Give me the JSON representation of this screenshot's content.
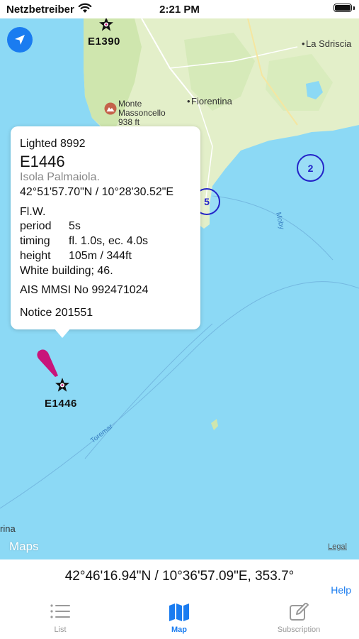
{
  "status_bar": {
    "carrier": "Netzbetreiber",
    "time": "2:21 PM",
    "battery_level": 1.0
  },
  "map": {
    "places": {
      "la_sdriscia": "La Sdriscia",
      "fiorentina": "Fiorentina",
      "monte_name_1": "Monte",
      "monte_name_2": "Massoncello",
      "monte_elev": "938 ft",
      "edge_label": "rina"
    },
    "routes": {
      "moby": "Moby",
      "toremar": "Toremar"
    },
    "markers": {
      "top": "E1390",
      "selected": "E1446"
    },
    "clusters": {
      "c1": "2",
      "c2": "5"
    },
    "attribution": {
      "maps": "Maps",
      "legal": "Legal"
    },
    "colors": {
      "sea": "#8cd9f5",
      "land": "#e3efc9",
      "pin": "#c8157a",
      "cluster": "#2323c8"
    }
  },
  "callout": {
    "category": "Lighted 8992",
    "id": "E1446",
    "location": "Isola Palmaiola.",
    "coords": "42°51'57.70\"N / 10°28'30.52\"E",
    "characteristic": "Fl.W.",
    "period_label": "period",
    "period_value": "5s",
    "timing_label": "timing",
    "timing_value": "fl. 1.0s, ec. 4.0s",
    "height_label": "height",
    "height_value": "105m / 344ft",
    "structure": "White building; 46.",
    "ais": "AIS MMSI No 992471024",
    "notice": "Notice 201551"
  },
  "position_readout": "42°46'16.94\"N / 10°36'57.09\"E, 353.7°",
  "help_label": "Help",
  "tabs": [
    {
      "label": "List",
      "icon": "list-icon",
      "active": false
    },
    {
      "label": "Map",
      "icon": "map-icon",
      "active": true
    },
    {
      "label": "Subscription",
      "icon": "compose-icon",
      "active": false
    }
  ]
}
